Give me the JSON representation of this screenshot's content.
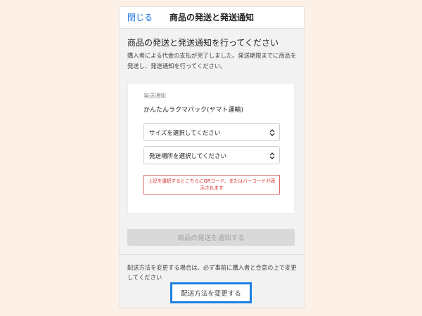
{
  "header": {
    "close_label": "閉じる",
    "title": "商品の発送と発送通知"
  },
  "main": {
    "heading": "商品の発送と発送通知を行ってください",
    "description": "購入者による代金の支払が完了しました。発送期限までに商品を発送し、発送通知を行ってください。"
  },
  "card": {
    "label": "発送通知",
    "shipping_method": "かんたんラクマパック(ヤマト運輸)",
    "size_select": "サイズを選択してください",
    "place_select": "発送場所を選択してください",
    "notice": "上記を選択するとこちらにQRコード、またはバーコードが表示されます"
  },
  "actions": {
    "notify_label": "商品の発送を通知する",
    "change_note": "配送方法を変更する場合は、必ず事前に購入者と合意の上で変更してください",
    "change_method_label": "配送方法を変更する"
  },
  "colors": {
    "accent": "#1e7fe0",
    "link": "#1a73e8",
    "warning": "#d62c2c",
    "disabled": "#d9d9d9"
  }
}
